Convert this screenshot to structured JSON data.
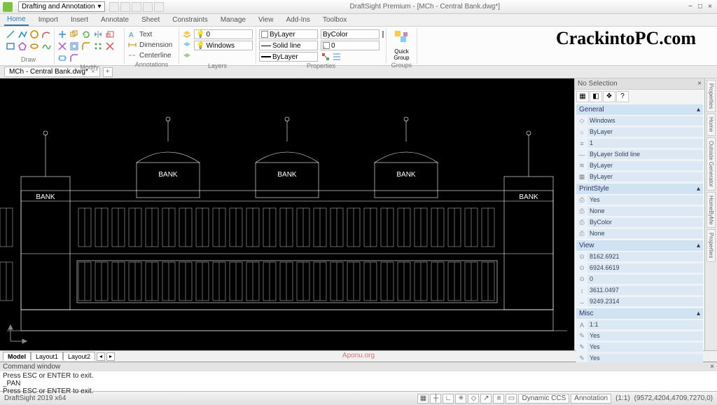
{
  "titlebar": {
    "workspace": "Drafting and Annotation",
    "title": "DraftSight Premium - [MCh - Central Bank.dwg*]"
  },
  "wincontrols": {
    "min": "−",
    "max": "□",
    "close": "×"
  },
  "menubar": {
    "tabs": [
      "Home",
      "Import",
      "Insert",
      "Annotate",
      "Sheet",
      "Constraints",
      "Manage",
      "View",
      "Add-Ins",
      "Toolbox"
    ],
    "active": 0
  },
  "ribbon": {
    "groups": {
      "draw": "Draw",
      "modify": "Modify",
      "annotations": "Annotations",
      "layers": "Layers",
      "properties": "Properties",
      "groups": "Groups"
    },
    "annot": {
      "text": "Text",
      "dimension": "Dimension",
      "centerline": "Centerline"
    },
    "layers": {
      "layer0": "0",
      "window": "Windows"
    },
    "props": {
      "color": "ByLayer",
      "linetype": "Solid line",
      "lineweight": "ByLayer",
      "bycolor": "ByColor",
      "zero": "0"
    },
    "quickgroup": "Quick\nGroup"
  },
  "watermark": "CrackintoPC.com",
  "doctab": {
    "name": "MCh - Central Bank.dwg*"
  },
  "proppanel": {
    "header": "No Selection",
    "sections": {
      "general": {
        "label": "General",
        "rows": [
          {
            "icon": "◇",
            "val": "Windows"
          },
          {
            "icon": "○",
            "val": "ByLayer"
          },
          {
            "icon": "≡",
            "val": "1"
          },
          {
            "icon": "—",
            "val": "ByLayer    Solid line"
          },
          {
            "icon": "≋",
            "val": "ByLayer"
          },
          {
            "icon": "▦",
            "val": "ByLayer"
          }
        ]
      },
      "printstyle": {
        "label": "PrintStyle",
        "rows": [
          {
            "icon": "⎙",
            "val": "Yes"
          },
          {
            "icon": "⎙",
            "val": "None"
          },
          {
            "icon": "⎙",
            "val": "ByColor"
          },
          {
            "icon": "⎙",
            "val": "None"
          }
        ]
      },
      "view": {
        "label": "View",
        "rows": [
          {
            "icon": "⊙",
            "val": "8162.6921"
          },
          {
            "icon": "⊙",
            "val": "6924.6619"
          },
          {
            "icon": "⊙",
            "val": "0"
          },
          {
            "icon": "↕",
            "val": "3611.0497"
          },
          {
            "icon": "↔",
            "val": "9249.2314"
          }
        ]
      },
      "misc": {
        "label": "Misc",
        "rows": [
          {
            "icon": "A",
            "val": "1:1"
          },
          {
            "icon": "✎",
            "val": "Yes"
          },
          {
            "icon": "✎",
            "val": "Yes"
          },
          {
            "icon": "✎",
            "val": "Yes"
          }
        ]
      }
    }
  },
  "sidetabs": [
    "Properties",
    "Home",
    "Outside Generator",
    "HomeByMe",
    "Properties"
  ],
  "modeltabs": {
    "tabs": [
      "Model",
      "Layout1",
      "Layout2"
    ],
    "active": 0
  },
  "cmdwin": {
    "title": "Command window",
    "lines": [
      "Press ESC or ENTER to exit.",
      "_PAN",
      "Press ESC or ENTER to exit."
    ]
  },
  "statusbar": {
    "left": "DraftSight 2019 x64",
    "dynccs": "Dynamic CCS",
    "annotation": "Annotation",
    "scale": "(1:1)",
    "coords": "(9572,4204,4709,7270,0)"
  },
  "aponu": "Aponu.org",
  "banklabel": "BANK"
}
